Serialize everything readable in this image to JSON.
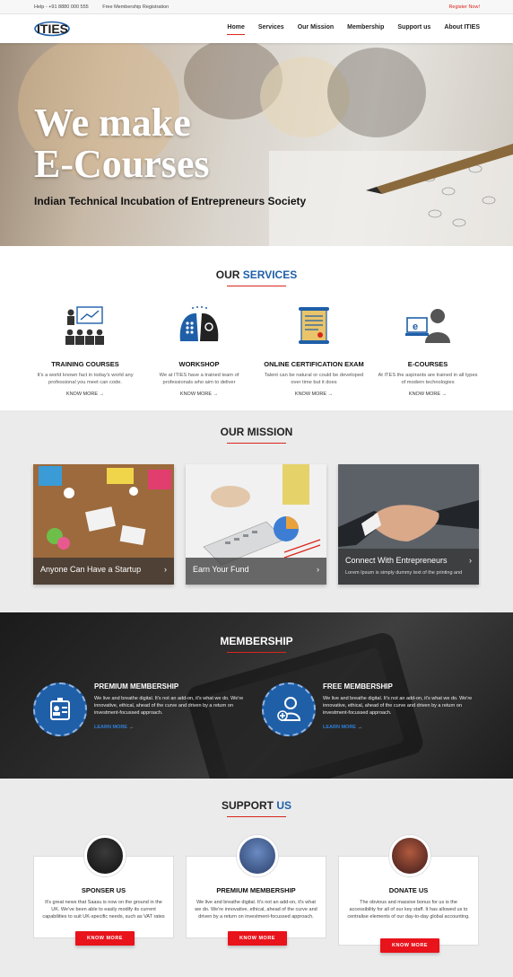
{
  "topbar": {
    "help": "Help - +91 8880 000 555",
    "free_reg": "Free Membership Registration",
    "register": "Register Now!"
  },
  "logo": {
    "text": "ITIES"
  },
  "nav": {
    "items": [
      "Home",
      "Services",
      "Our Mission",
      "Membership",
      "Support us",
      "About ITIES"
    ]
  },
  "hero": {
    "line1": "We make",
    "line2": "E-Courses",
    "subtitle": "Indian Technical Incubation of Entrepreneurs Society"
  },
  "services": {
    "title_a": "OUR",
    "title_b": "SERVICES",
    "items": [
      {
        "title": "TRAINING COURSES",
        "desc": "It's a world known fact in today's world any professional you meet can code.",
        "link": "KNOW MORE",
        "icon": "presentation-icon"
      },
      {
        "title": "WORKSHOP",
        "desc": "We at ITIES have a trained team of professionals who aim to deliver",
        "link": "KNOW MORE",
        "icon": "brain-heads-icon"
      },
      {
        "title": "ONLINE CERTIFICATION EXAM",
        "desc": "Talent can be natural or could be developed over time but it does",
        "link": "KNOW MORE",
        "icon": "certificate-scroll-icon"
      },
      {
        "title": "E-COURSES",
        "desc": "At ITES the aspirants are trained in all types of modern technologies",
        "link": "KNOW MORE",
        "icon": "elearning-user-icon"
      }
    ]
  },
  "mission": {
    "title": "OUR MISSION",
    "cards": [
      {
        "caption": "Anyone Can Have a Startup",
        "sub": ""
      },
      {
        "caption": "Earn Your Fund",
        "sub": ""
      },
      {
        "caption": "Connect With Entrepreneurs",
        "sub": "Lorem Ipsum is simply dummy text of the printing and"
      }
    ]
  },
  "membership": {
    "title": "MEMBERSHIP",
    "items": [
      {
        "title": "PREMIUM MEMBERSHIP",
        "desc": "We live and breathe digital. It's not an add-on, it's what we do. We're innovative, ethical, ahead of the curve and driven by a return on investment-focussed approach.",
        "link": "LEARN MORE",
        "icon": "id-badge-icon"
      },
      {
        "title": "FREE MEMBERSHIP",
        "desc": "We live and breathe digital. It's not an add-on, it's what we do. We're innovative, ethical, ahead of the curve and driven by a return on investment-focussed approach.",
        "link": "LEARN MORE",
        "icon": "add-user-icon"
      }
    ]
  },
  "support": {
    "title_a": "SUPPORT",
    "title_b": "US",
    "cards": [
      {
        "title": "SPONSER US",
        "desc": "It's great news that Saasu is now on the ground in the UK. We've been able to easily modify its current capabilities to suit UK-specific needs, such as VAT rates",
        "button": "KNOW MORE"
      },
      {
        "title": "PREMIUM MEMBERSHIP",
        "desc": "We live and breathe digital. It's not an add-on, it's what we do. We're innovative, ethical, ahead of the curve and driven by a return on investment-focussed approach.",
        "button": "KNOW MORE"
      },
      {
        "title": "DONATE US",
        "desc": "The obvious and massive bonus for us is the accessibility for all of our key staff. It has allowed us to centralise elements of our day-to-day global accounting.",
        "button": "KNOW MORE"
      }
    ]
  },
  "colors": {
    "accent_red": "#d9261c",
    "brand_blue": "#1f5fa8",
    "button_red": "#e8131b"
  }
}
